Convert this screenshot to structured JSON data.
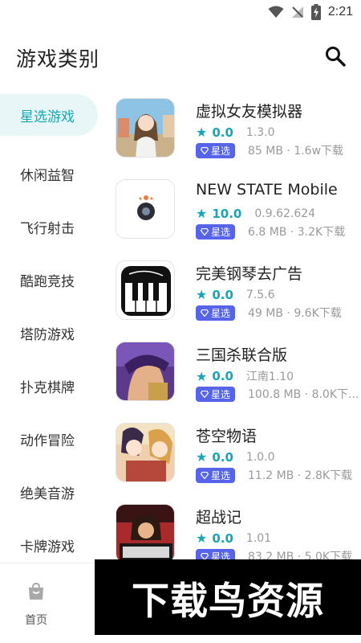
{
  "status": {
    "time": "2:21"
  },
  "header": {
    "title": "游戏类别",
    "search_icon": "search-icon"
  },
  "categories": [
    {
      "label": "星选游戏",
      "active": true
    },
    {
      "label": "休闲益智"
    },
    {
      "label": "飞行射击"
    },
    {
      "label": "酷跑竞技"
    },
    {
      "label": "塔防游戏"
    },
    {
      "label": "扑克棋牌"
    },
    {
      "label": "动作冒险"
    },
    {
      "label": "绝美音游"
    },
    {
      "label": "卡牌游戏"
    }
  ],
  "games": [
    {
      "name": "虚拟女友模拟器",
      "score": "0.0",
      "version": "1.3.0",
      "badge": "星选",
      "info": "85 MB · 1.6w下载",
      "icon": "anime-girl-icon"
    },
    {
      "name": "NEW STATE Mobile",
      "score": "10.0",
      "version": "0.9.62.624",
      "badge": "星选",
      "info": "6.8 MB · 3.2K下载",
      "icon": "new-state-icon"
    },
    {
      "name": "完美钢琴去广告",
      "score": "0.0",
      "version": "7.5.6",
      "badge": "星选",
      "info": "49 MB · 9.6K下载",
      "icon": "piano-icon"
    },
    {
      "name": "三国杀联合版",
      "score": "0.0",
      "version": "江南1.10",
      "badge": "星选",
      "info": "100.8 MB · 8.0K下...",
      "icon": "sanguosha-icon"
    },
    {
      "name": "苍空物语",
      "score": "0.0",
      "version": "1.0.0",
      "badge": "星选",
      "info": "11.2 MB · 2.8K下载",
      "icon": "cangkong-icon"
    },
    {
      "name": "超战记",
      "score": "0.0",
      "version": "1.01",
      "badge": "星选",
      "info": "83.2 MB · 5.0K下载",
      "icon": "ultra-battle-icon"
    }
  ],
  "nav": {
    "home_label": "首页"
  },
  "watermark": {
    "text": "下载鸟资源"
  },
  "colors": {
    "accent": "#16a8b6",
    "badge": "#5564e8",
    "active_bg": "#e8f6f7"
  }
}
